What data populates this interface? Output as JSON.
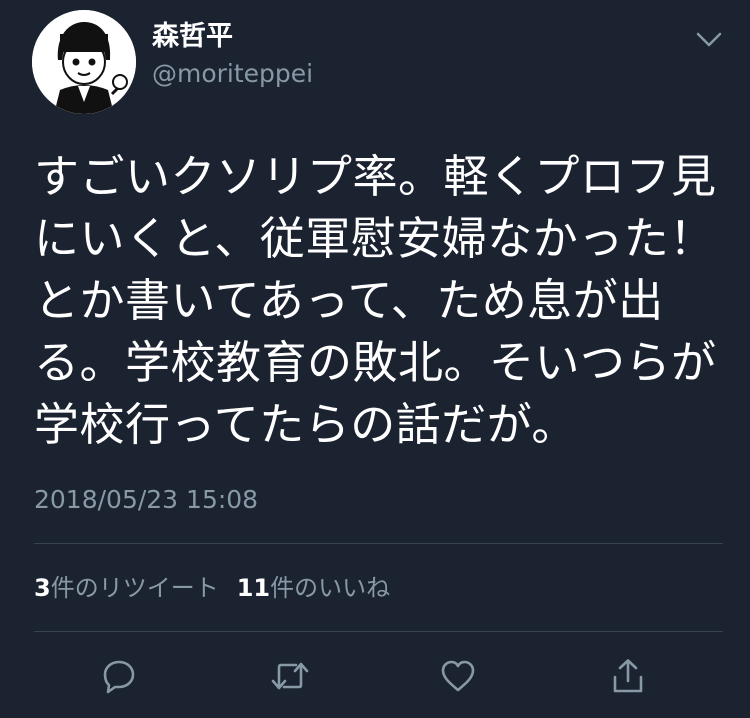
{
  "author": {
    "display_name": "森哲平",
    "handle": "@moriteppei"
  },
  "tweet": {
    "lines": [
      "すごいクソリプ率。軽くプロフ見",
      "にいくと、従軍慰安婦なかった！",
      "とか書いてあって、ため息が出",
      "る。学校教育の敗北。そいつらが",
      "学校行ってたらの話だが。"
    ],
    "timestamp": "2018/05/23 15:08"
  },
  "stats": {
    "retweet_count": "3",
    "retweet_label": "件のリツイート",
    "like_count": "11",
    "like_label": "件のいいね"
  },
  "icons": {
    "caret": "chevron-down-icon",
    "reply": "reply-icon",
    "retweet": "retweet-icon",
    "like": "heart-icon",
    "share": "share-icon"
  },
  "colors": {
    "background": "#1b2230",
    "text": "#ffffff",
    "secondary": "#8899a6",
    "divider": "#38444d"
  }
}
